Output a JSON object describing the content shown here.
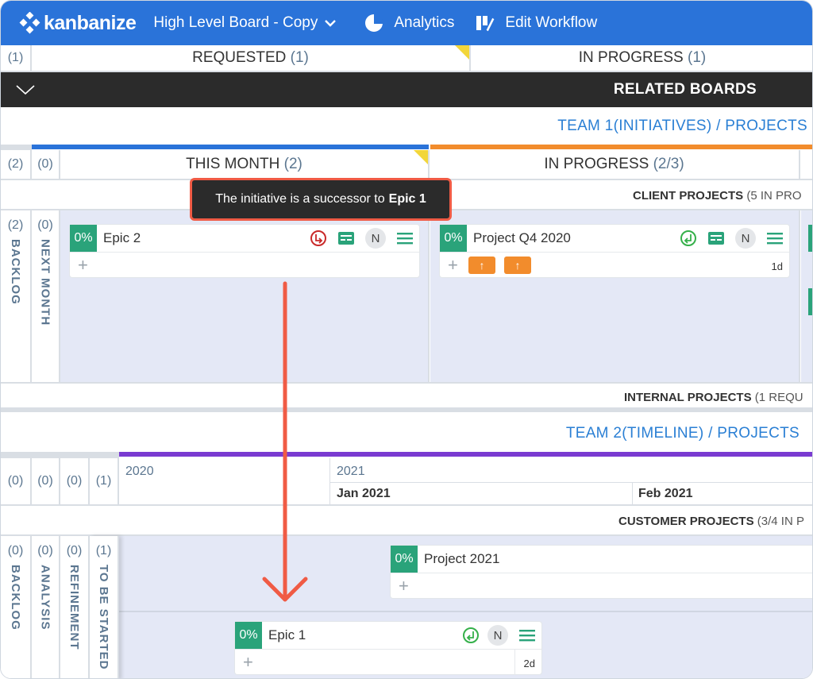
{
  "app": {
    "brand": "kanbanize",
    "board_title": "High Level Board - Copy",
    "nav": {
      "analytics": "Analytics",
      "edit_workflow": "Edit Workflow"
    }
  },
  "top_columns": {
    "left_count": "(1)",
    "requested": {
      "label": "REQUESTED",
      "count": "(1)"
    },
    "in_progress": {
      "label": "IN PROGRESS",
      "count": "(1)"
    }
  },
  "related_boards": {
    "title": "RELATED BOARDS"
  },
  "team1": {
    "link": "TEAM 1(INITIATIVES) / PROJECTS",
    "counts": [
      "(2)",
      "(0)"
    ],
    "this_month": {
      "label": "THIS MONTH",
      "count": "(2)"
    },
    "in_progress": {
      "label": "IN PROGRESS",
      "count": "(2/3)"
    },
    "lane_client": {
      "label": "CLIENT PROJECTS",
      "rest": "(5 IN PRO"
    },
    "lane_internal": {
      "label": "INTERNAL PROJECTS",
      "rest": "(1 REQU"
    },
    "vertical_cols": [
      {
        "count": "(2)",
        "label": "BACKLOG"
      },
      {
        "count": "(0)",
        "label": "NEXT MONTH"
      }
    ],
    "cards": {
      "epic2": {
        "pct": "0%",
        "name": "Epic 2",
        "initial": "N"
      },
      "projq4": {
        "pct": "0%",
        "name": "Project Q4 2020",
        "initial": "N",
        "age": "1d",
        "tag1": "↑",
        "tag2": "↑"
      }
    }
  },
  "tooltip": {
    "text": "The initiative is a successor to",
    "bold": "Epic 1"
  },
  "team2": {
    "link": "TEAM 2(TIMELINE) / PROJECTS",
    "counts": [
      "(0)",
      "(0)",
      "(0)",
      "(1)"
    ],
    "timeline": {
      "year1": "2020",
      "year2": "2021",
      "month1": "Jan 2021",
      "month2": "Feb 2021"
    },
    "lane_customer": {
      "label": "CUSTOMER PROJECTS",
      "rest": "(3/4 IN P"
    },
    "vertical_cols": [
      {
        "count": "(0)",
        "label": "BACKLOG"
      },
      {
        "count": "(0)",
        "label": "ANALYSIS"
      },
      {
        "count": "(0)",
        "label": "REFINEMENT"
      },
      {
        "count": "(1)",
        "label": "TO BE STARTED"
      }
    ],
    "cards": {
      "proj2021": {
        "pct": "0%",
        "name": "Project 2021"
      },
      "epic1": {
        "pct": "0%",
        "name": "Epic 1",
        "initial": "N",
        "age": "2d"
      }
    }
  },
  "colors": {
    "topbar": "#2a73d9",
    "accent_orange": "#f28c2c",
    "accent_green": "#2aa37a",
    "arrow": "#f05b45",
    "timeline_purple": "#7a3bd1"
  }
}
